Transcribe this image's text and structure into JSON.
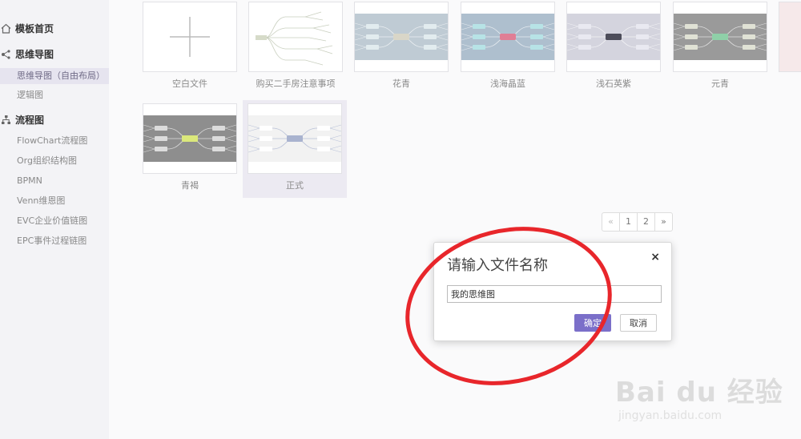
{
  "sidebar": {
    "groups": [
      {
        "label": "模板首页",
        "icon": "home-icon"
      },
      {
        "label": "思维导图",
        "icon": "mindmap-icon"
      },
      {
        "label": "流程图",
        "icon": "flowchart-icon"
      }
    ],
    "mindmap_items": [
      "思维导图（自由布局）",
      "逻辑图"
    ],
    "flow_items": [
      "FlowChart流程图",
      "Org组织结构图",
      "BPMN",
      "Venn维恩图",
      "EVC企业价值链图",
      "EPC事件过程链图"
    ]
  },
  "templates": [
    {
      "label": "空白文件",
      "style": "blank"
    },
    {
      "label": "购买二手房注意事项",
      "style": "tree"
    },
    {
      "label": "花青",
      "style": "map",
      "bg": "#bfcbd4",
      "node": "#e2ecef",
      "center": "#d9d6c8"
    },
    {
      "label": "浅海晶蓝",
      "style": "map",
      "bg": "#aebfce",
      "node": "#b7e3e6",
      "center": "#e07e95"
    },
    {
      "label": "浅石英紫",
      "style": "map",
      "bg": "#d4d4de",
      "node": "#e9e9f1",
      "center": "#4d4d5a"
    },
    {
      "label": "元青",
      "style": "map",
      "bg": "#9a9a9a",
      "node": "#e0e2d5",
      "center": "#8fd0a8"
    },
    {
      "label": "青褐",
      "style": "map",
      "bg": "#8e8e8e",
      "node": "#dcdcdc",
      "center": "#dbe87b"
    },
    {
      "label": "正式",
      "style": "map",
      "bg": "#f2f2f2",
      "node": "#ffffff",
      "center": "#a9b3cf"
    }
  ],
  "pagination": {
    "prev": "«",
    "pages": [
      "1",
      "2"
    ],
    "next": "»"
  },
  "dialog": {
    "title": "请输入文件名称",
    "close": "×",
    "input_value": "我的思维图",
    "ok": "确定",
    "cancel": "取消"
  },
  "colors": {
    "accent": "#7b6fc9",
    "annotation": "#e8262b"
  },
  "watermark": {
    "logo": "Bai du 经验",
    "url": "jingyan.baidu.com"
  }
}
